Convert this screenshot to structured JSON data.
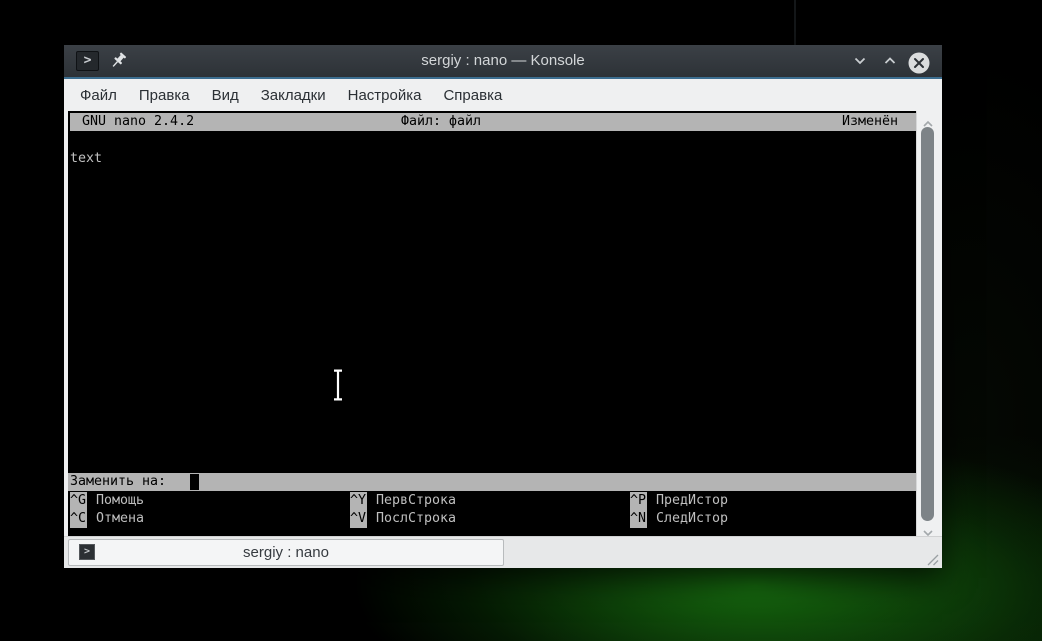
{
  "colors": {
    "titlebar_bg": "#31363b",
    "titlebar_accent_line": "#3c6e90",
    "ui_bg": "#eff0f1",
    "nano_bar_bg": "#b4b4b4",
    "terminal_bg": "#000000",
    "terminal_fg": "#c0c0c0",
    "desktop_glow_green": "#186e10"
  },
  "window": {
    "titlebar": {
      "app_icon_glyph": ">",
      "title": "sergiy : nano — Konsole"
    },
    "menubar": {
      "items": [
        {
          "label": "Файл"
        },
        {
          "label": "Правка"
        },
        {
          "label": "Вид"
        },
        {
          "label": "Закладки"
        },
        {
          "label": "Настройка"
        },
        {
          "label": "Справка"
        }
      ]
    },
    "terminal": {
      "nano": {
        "header": {
          "left": "GNU nano 2.4.2",
          "center": "Файл: файл",
          "right": "Изменён"
        },
        "buffer_text": "text",
        "prompt": {
          "label": "Заменить на:"
        },
        "shortcut_rows": [
          {
            "cols": [
              {
                "key": "^G",
                "label": "Помощь"
              },
              {
                "key": "^Y",
                "label": "ПервСтрока"
              },
              {
                "key": "^P",
                "label": "ПредИстор"
              }
            ]
          },
          {
            "cols": [
              {
                "key": "^C",
                "label": "Отмена"
              },
              {
                "key": "^V",
                "label": "ПослСтрока"
              },
              {
                "key": "^N",
                "label": "СледИстор"
              }
            ]
          }
        ]
      }
    },
    "tabbar": {
      "tabs": [
        {
          "icon_glyph": ">",
          "label": "sergiy : nano"
        }
      ]
    }
  }
}
